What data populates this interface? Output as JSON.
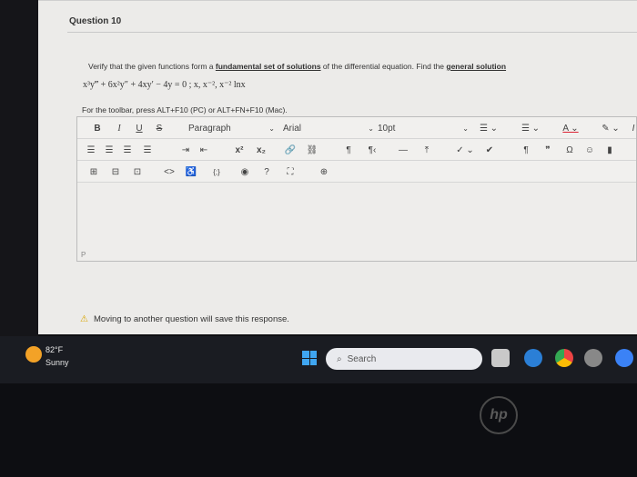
{
  "question": {
    "title": "Question 10",
    "prompt_prefix": "Verify that the given functions form a ",
    "prompt_term": "fundamental set of solutions",
    "prompt_middle": " of the differential equation. Find the ",
    "prompt_general": "general solution",
    "equation": "x³y‴ + 6x²y″ + 4xy′ − 4y = 0 ;  x, x⁻², x⁻² lnx",
    "toolbar_note": "For the toolbar, press ALT+F10 (PC) or ALT+FN+F10 (Mac)."
  },
  "toolbar": {
    "bold": "B",
    "italic": "I",
    "underline": "U",
    "strike": "S",
    "paragraph": "Paragraph",
    "font": "Arial",
    "size": "10pt",
    "superscript": "x²",
    "subscript": "x₂",
    "pilcrow_ltr": "¶",
    "pilcrow_rtl": "¶‹",
    "pilcrow_mark": "¶",
    "quote": "❞",
    "omega": "Ω",
    "code": "<>",
    "braces": "{;}"
  },
  "editor": {
    "path_label": "P"
  },
  "warning": {
    "text": "Moving to another question will save this response."
  },
  "taskbar": {
    "temperature": "82°F",
    "condition": "Sunny",
    "search_placeholder": "Search"
  },
  "device": {
    "logo": "hp"
  }
}
